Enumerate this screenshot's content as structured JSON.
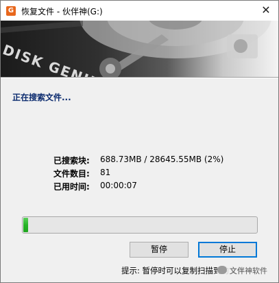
{
  "window": {
    "title": "恢复文件 - 伙伴神(G:)",
    "app_icon": "diskgenius-app-icon",
    "close_label": "✕"
  },
  "banner": {
    "text": "DISK GENIUS"
  },
  "status": {
    "heading": "正在搜索文件..."
  },
  "info": {
    "searched_blocks_label": "已搜索块:",
    "searched_blocks_value": "688.73MB / 28645.55MB (2%)",
    "file_count_label": "文件数目:",
    "file_count_value": "81",
    "elapsed_label": "已用时间:",
    "elapsed_value": "00:00:07"
  },
  "progress": {
    "percent": 2,
    "color": "#27b427"
  },
  "buttons": {
    "pause_label": "暂停",
    "stop_label": "停止"
  },
  "hint": {
    "text": "提示: 暂停时可以复制扫描到的文件"
  },
  "watermark": {
    "text": "文伴神软件"
  }
}
